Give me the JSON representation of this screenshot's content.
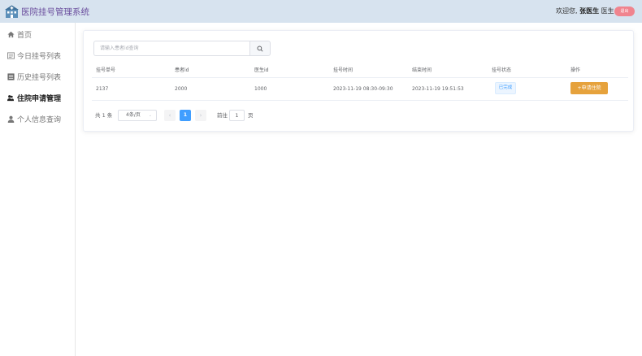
{
  "header": {
    "title": "医院挂号管理系统",
    "welcome_prefix": "欢迎您,",
    "user_name": "张医生",
    "user_role": "医生",
    "logout_label": "退出"
  },
  "sidebar": {
    "items": [
      {
        "label": "首页",
        "icon": "home-icon"
      },
      {
        "label": "今日挂号列表",
        "icon": "list-icon"
      },
      {
        "label": "历史挂号列表",
        "icon": "history-icon"
      },
      {
        "label": "住院申请管理",
        "icon": "bed-icon",
        "active": true
      },
      {
        "label": "个人信息查询",
        "icon": "user-icon"
      }
    ]
  },
  "search": {
    "placeholder": "请输入患者id查询"
  },
  "table": {
    "headers": [
      "挂号单号",
      "患者id",
      "医生id",
      "挂号时间",
      "结束时间",
      "挂号状态",
      "操作"
    ],
    "rows": [
      {
        "order_no": "2137",
        "patient_id": "2000",
        "doctor_id": "1000",
        "register_time": "2023-11-19 08:30-09:30",
        "end_time": "2023-11-19 19:51:53",
        "status": "已完成",
        "action": "申请住院"
      }
    ]
  },
  "pagination": {
    "total_text": "共 1 条",
    "page_size": "4条/页",
    "current_page": "1",
    "goto_label": "前往",
    "goto_value": "1",
    "page_unit": "页"
  },
  "colors": {
    "header_bg": "#d7e3ef",
    "title": "#6b4f9e",
    "logout": "#f0848e",
    "primary": "#409eff",
    "warning": "#e6a23c"
  }
}
